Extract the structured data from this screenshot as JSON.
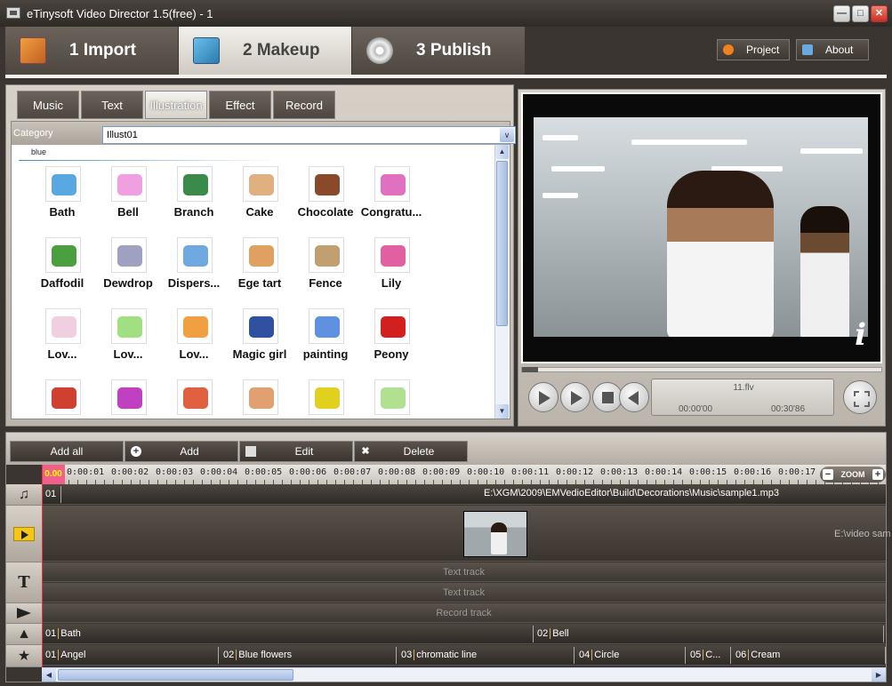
{
  "window": {
    "title": "eTinysoft Video Director 1.5(free) - 1",
    "min": "—",
    "max": "□",
    "close": "✕",
    "app_icon": "video-camera-icon"
  },
  "steps": [
    {
      "label": "1 Import",
      "icon": "import-icon",
      "active": false
    },
    {
      "label": "2 Makeup",
      "icon": "makeup-icon",
      "active": true
    },
    {
      "label": "3 Publish",
      "icon": "disc-icon",
      "active": false
    }
  ],
  "top_buttons": {
    "project": "Project",
    "about": "About"
  },
  "subtabs": [
    {
      "label": "Music",
      "active": false
    },
    {
      "label": "Text",
      "active": false
    },
    {
      "label": "Illustration",
      "active": true
    },
    {
      "label": "Effect",
      "active": false
    },
    {
      "label": "Record",
      "active": false
    }
  ],
  "category": {
    "label": "Category",
    "value": "Illust01",
    "dropdown_glyph": "∨"
  },
  "group_label": "blue",
  "items": [
    {
      "label": "Bath",
      "color": "#5aa8e0"
    },
    {
      "label": "Bell",
      "color": "#f0a0e0"
    },
    {
      "label": "Branch",
      "color": "#3a8a4a"
    },
    {
      "label": "Cake",
      "color": "#e0b080"
    },
    {
      "label": "Chocolate",
      "color": "#8a4a2a"
    },
    {
      "label": "Congratu...",
      "color": "#e070c0"
    },
    {
      "label": "Daffodil",
      "color": "#4aa040"
    },
    {
      "label": "Dewdrop",
      "color": "#a0a0c0"
    },
    {
      "label": "Dispers...",
      "color": "#70a8e0"
    },
    {
      "label": "Ege tart",
      "color": "#e0a060"
    },
    {
      "label": "Fence",
      "color": "#c0a070"
    },
    {
      "label": "Lily",
      "color": "#e060a0"
    },
    {
      "label": "Lov...",
      "color": "#f0d0e0"
    },
    {
      "label": "Lov...",
      "color": "#a0e080"
    },
    {
      "label": "Lov...",
      "color": "#f0a040"
    },
    {
      "label": "Magic girl",
      "color": "#3050a0"
    },
    {
      "label": "painting",
      "color": "#6090e0"
    },
    {
      "label": "Peony",
      "color": "#d02020"
    },
    {
      "label": "",
      "color": "#d04030"
    },
    {
      "label": "",
      "color": "#c040c0"
    },
    {
      "label": "",
      "color": "#e06040"
    },
    {
      "label": "",
      "color": "#e0a070"
    },
    {
      "label": "",
      "color": "#e0d020"
    },
    {
      "label": "",
      "color": "#b0e090"
    }
  ],
  "preview": {
    "filename": "11.flv",
    "time_start": "00:00'00",
    "time_end": "00:30'86",
    "info_glyph": "i"
  },
  "timeline_buttons": {
    "add_all": "Add all",
    "add": "Add",
    "edit": "Edit",
    "delete": "Delete",
    "add_glyph": "+",
    "delete_glyph": "✖"
  },
  "ruler": {
    "cursor": "0.00",
    "ticks": [
      "0:00:01",
      "0:00:02",
      "0:00:03",
      "0:00:04",
      "0:00:05",
      "0:00:06",
      "0:00:07",
      "0:00:08",
      "0:00:09",
      "0:00:10",
      "0:00:11",
      "0:00:12",
      "0:00:13",
      "0:00:14",
      "0:00:15",
      "0:00:16",
      "0:00:17"
    ],
    "zoom_label": "ZOOM",
    "zoom_out": "−",
    "zoom_in": "+"
  },
  "tracks": {
    "music": {
      "index": "01",
      "path": "E:\\XGM\\2009\\EMVedioEditor\\Build\\Decorations\\Music\\sample1.mp3"
    },
    "video": {
      "path": "E:\\video sam"
    },
    "text1": "Text track",
    "text2": "Text track",
    "record": "Record track",
    "illustration": [
      {
        "index": "01",
        "label": "Bath"
      },
      {
        "index": "02",
        "label": "Bell"
      }
    ],
    "effect": [
      {
        "index": "01",
        "label": "Angel"
      },
      {
        "index": "02",
        "label": "Blue flowers"
      },
      {
        "index": "03",
        "label": "chromatic line"
      },
      {
        "index": "04",
        "label": "Circle"
      },
      {
        "index": "05",
        "label": "C..."
      },
      {
        "index": "06",
        "label": "Cream"
      }
    ]
  },
  "track_icons": {
    "music": "♫",
    "text": "T",
    "illustration": "▲",
    "effect": "★"
  },
  "scroll": {
    "up": "▲",
    "down": "▼",
    "left": "◀",
    "right": "▶"
  }
}
